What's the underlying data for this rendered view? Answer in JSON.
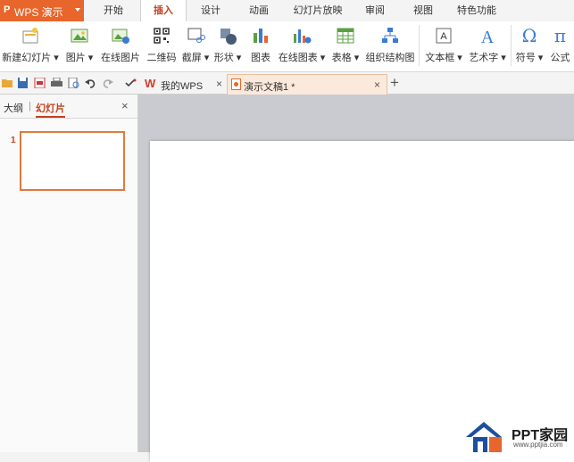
{
  "app": {
    "logo_glyph": "P",
    "name": "WPS 演示"
  },
  "menu_tabs": [
    {
      "label": "开始",
      "active": false
    },
    {
      "label": "插入",
      "active": true
    },
    {
      "label": "设计",
      "active": false
    },
    {
      "label": "动画",
      "active": false
    },
    {
      "label": "幻灯片放映",
      "active": false
    },
    {
      "label": "审阅",
      "active": false
    },
    {
      "label": "视图",
      "active": false
    },
    {
      "label": "特色功能",
      "active": false
    }
  ],
  "ribbon": [
    {
      "label": "新建幻灯片 ▾",
      "icon": "new-slide-icon"
    },
    {
      "label": "图片 ▾",
      "icon": "picture-icon"
    },
    {
      "label": "在线图片",
      "icon": "online-picture-icon"
    },
    {
      "label": "二维码",
      "icon": "qrcode-icon"
    },
    {
      "label": "截屏 ▾",
      "icon": "screenshot-icon"
    },
    {
      "label": "形状 ▾",
      "icon": "shapes-icon"
    },
    {
      "label": "图表",
      "icon": "chart-icon"
    },
    {
      "label": "在线图表 ▾",
      "icon": "online-chart-icon"
    },
    {
      "label": "表格 ▾",
      "icon": "table-icon"
    },
    {
      "label": "组织结构图",
      "icon": "org-chart-icon"
    },
    {
      "label": "文本框 ▾",
      "icon": "textbox-icon"
    },
    {
      "label": "艺术字 ▾",
      "icon": "wordart-icon"
    },
    {
      "label": "符号 ▾",
      "icon": "symbol-omega-icon",
      "glyph": "Ω"
    },
    {
      "label": "公式",
      "icon": "formula-pi-icon",
      "glyph": "π"
    }
  ],
  "doc_tabs": [
    {
      "label": "我的WPS",
      "icon": "wps-w-icon",
      "glyph": "W",
      "active": false
    },
    {
      "label": "演示文稿1 *",
      "icon": "presentation-file-icon",
      "active": true
    }
  ],
  "new_tab_glyph": "+",
  "close_glyph": "×",
  "left_panel": {
    "tab_outline": "大纲",
    "tab_divider": "|",
    "tab_slides": "幻灯片",
    "slide_number": "1"
  },
  "watermark": {
    "title": "PPT家园",
    "url": "www.pptjia.com"
  },
  "colors": {
    "accent": "#e8652b",
    "active_text": "#c4411e",
    "canvas_bg": "#c9cbd0"
  }
}
